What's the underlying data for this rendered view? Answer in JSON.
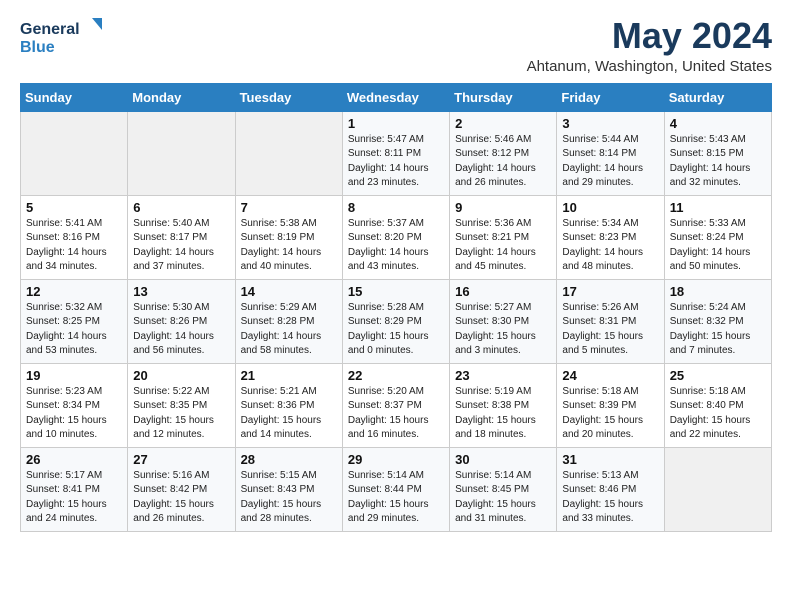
{
  "header": {
    "logo_line1": "General",
    "logo_line2": "Blue",
    "month_title": "May 2024",
    "location": "Ahtanum, Washington, United States"
  },
  "days_of_week": [
    "Sunday",
    "Monday",
    "Tuesday",
    "Wednesday",
    "Thursday",
    "Friday",
    "Saturday"
  ],
  "weeks": [
    [
      {
        "day": "",
        "info": ""
      },
      {
        "day": "",
        "info": ""
      },
      {
        "day": "",
        "info": ""
      },
      {
        "day": "1",
        "info": "Sunrise: 5:47 AM\nSunset: 8:11 PM\nDaylight: 14 hours\nand 23 minutes."
      },
      {
        "day": "2",
        "info": "Sunrise: 5:46 AM\nSunset: 8:12 PM\nDaylight: 14 hours\nand 26 minutes."
      },
      {
        "day": "3",
        "info": "Sunrise: 5:44 AM\nSunset: 8:14 PM\nDaylight: 14 hours\nand 29 minutes."
      },
      {
        "day": "4",
        "info": "Sunrise: 5:43 AM\nSunset: 8:15 PM\nDaylight: 14 hours\nand 32 minutes."
      }
    ],
    [
      {
        "day": "5",
        "info": "Sunrise: 5:41 AM\nSunset: 8:16 PM\nDaylight: 14 hours\nand 34 minutes."
      },
      {
        "day": "6",
        "info": "Sunrise: 5:40 AM\nSunset: 8:17 PM\nDaylight: 14 hours\nand 37 minutes."
      },
      {
        "day": "7",
        "info": "Sunrise: 5:38 AM\nSunset: 8:19 PM\nDaylight: 14 hours\nand 40 minutes."
      },
      {
        "day": "8",
        "info": "Sunrise: 5:37 AM\nSunset: 8:20 PM\nDaylight: 14 hours\nand 43 minutes."
      },
      {
        "day": "9",
        "info": "Sunrise: 5:36 AM\nSunset: 8:21 PM\nDaylight: 14 hours\nand 45 minutes."
      },
      {
        "day": "10",
        "info": "Sunrise: 5:34 AM\nSunset: 8:23 PM\nDaylight: 14 hours\nand 48 minutes."
      },
      {
        "day": "11",
        "info": "Sunrise: 5:33 AM\nSunset: 8:24 PM\nDaylight: 14 hours\nand 50 minutes."
      }
    ],
    [
      {
        "day": "12",
        "info": "Sunrise: 5:32 AM\nSunset: 8:25 PM\nDaylight: 14 hours\nand 53 minutes."
      },
      {
        "day": "13",
        "info": "Sunrise: 5:30 AM\nSunset: 8:26 PM\nDaylight: 14 hours\nand 56 minutes."
      },
      {
        "day": "14",
        "info": "Sunrise: 5:29 AM\nSunset: 8:28 PM\nDaylight: 14 hours\nand 58 minutes."
      },
      {
        "day": "15",
        "info": "Sunrise: 5:28 AM\nSunset: 8:29 PM\nDaylight: 15 hours\nand 0 minutes."
      },
      {
        "day": "16",
        "info": "Sunrise: 5:27 AM\nSunset: 8:30 PM\nDaylight: 15 hours\nand 3 minutes."
      },
      {
        "day": "17",
        "info": "Sunrise: 5:26 AM\nSunset: 8:31 PM\nDaylight: 15 hours\nand 5 minutes."
      },
      {
        "day": "18",
        "info": "Sunrise: 5:24 AM\nSunset: 8:32 PM\nDaylight: 15 hours\nand 7 minutes."
      }
    ],
    [
      {
        "day": "19",
        "info": "Sunrise: 5:23 AM\nSunset: 8:34 PM\nDaylight: 15 hours\nand 10 minutes."
      },
      {
        "day": "20",
        "info": "Sunrise: 5:22 AM\nSunset: 8:35 PM\nDaylight: 15 hours\nand 12 minutes."
      },
      {
        "day": "21",
        "info": "Sunrise: 5:21 AM\nSunset: 8:36 PM\nDaylight: 15 hours\nand 14 minutes."
      },
      {
        "day": "22",
        "info": "Sunrise: 5:20 AM\nSunset: 8:37 PM\nDaylight: 15 hours\nand 16 minutes."
      },
      {
        "day": "23",
        "info": "Sunrise: 5:19 AM\nSunset: 8:38 PM\nDaylight: 15 hours\nand 18 minutes."
      },
      {
        "day": "24",
        "info": "Sunrise: 5:18 AM\nSunset: 8:39 PM\nDaylight: 15 hours\nand 20 minutes."
      },
      {
        "day": "25",
        "info": "Sunrise: 5:18 AM\nSunset: 8:40 PM\nDaylight: 15 hours\nand 22 minutes."
      }
    ],
    [
      {
        "day": "26",
        "info": "Sunrise: 5:17 AM\nSunset: 8:41 PM\nDaylight: 15 hours\nand 24 minutes."
      },
      {
        "day": "27",
        "info": "Sunrise: 5:16 AM\nSunset: 8:42 PM\nDaylight: 15 hours\nand 26 minutes."
      },
      {
        "day": "28",
        "info": "Sunrise: 5:15 AM\nSunset: 8:43 PM\nDaylight: 15 hours\nand 28 minutes."
      },
      {
        "day": "29",
        "info": "Sunrise: 5:14 AM\nSunset: 8:44 PM\nDaylight: 15 hours\nand 29 minutes."
      },
      {
        "day": "30",
        "info": "Sunrise: 5:14 AM\nSunset: 8:45 PM\nDaylight: 15 hours\nand 31 minutes."
      },
      {
        "day": "31",
        "info": "Sunrise: 5:13 AM\nSunset: 8:46 PM\nDaylight: 15 hours\nand 33 minutes."
      },
      {
        "day": "",
        "info": ""
      }
    ]
  ]
}
